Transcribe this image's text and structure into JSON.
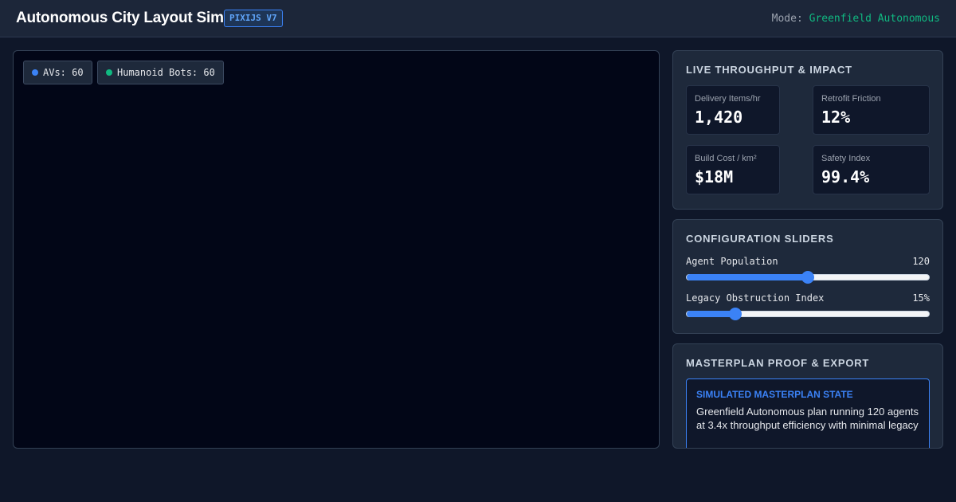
{
  "header": {
    "title": "Autonomous City Layout Sim",
    "badge": "PIXIJS V7",
    "mode_label": "Mode:",
    "mode_value": "Greenfield Autonomous"
  },
  "canvas": {
    "legend": [
      {
        "label": "AVs: 60",
        "color": "#3b82f6"
      },
      {
        "label": "Humanoid Bots: 60",
        "color": "#10b981"
      }
    ]
  },
  "stats_panel": {
    "title": "LIVE THROUGHPUT & IMPACT",
    "stats": [
      {
        "label": "Delivery Items/hr",
        "value": "1,420"
      },
      {
        "label": "Retrofit Friction",
        "value": "12%"
      },
      {
        "label": "Build Cost / km²",
        "value": "$18M"
      },
      {
        "label": "Safety Index",
        "value": "99.4%"
      }
    ]
  },
  "config_panel": {
    "title": "CONFIGURATION SLIDERS",
    "sliders": [
      {
        "label": "Agent Population",
        "value_text": "120",
        "fraction": 0.5
      },
      {
        "label": "Legacy Obstruction Index",
        "value_text": "15%",
        "fraction": 0.2
      }
    ]
  },
  "export_panel": {
    "title": "MASTERPLAN PROOF & EXPORT",
    "box_heading": "SIMULATED MASTERPLAN STATE",
    "box_text": "Greenfield Autonomous plan running 120 agents at 3.4x throughput efficiency with minimal legacy"
  },
  "colors": {
    "accent": "#3b82f6",
    "success": "#10b981"
  }
}
